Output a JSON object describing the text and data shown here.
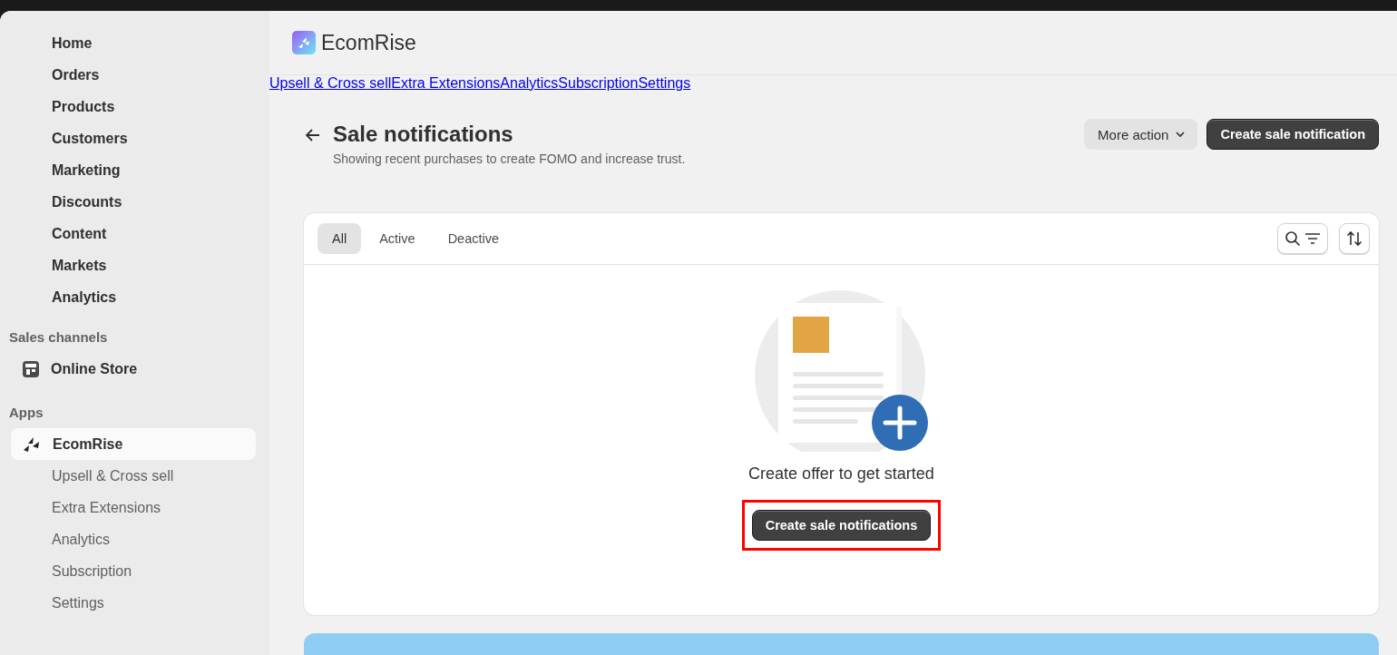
{
  "sidebar": {
    "main_items": [
      "Home",
      "Orders",
      "Products",
      "Customers",
      "Marketing",
      "Discounts",
      "Content",
      "Markets",
      "Analytics"
    ],
    "sales_channels": {
      "heading": "Sales channels",
      "items": [
        "Online Store"
      ]
    },
    "apps": {
      "heading": "Apps",
      "items": [
        {
          "label": "EcomRise",
          "kind": "app",
          "selected": true
        },
        {
          "label": "Upsell & Cross sell",
          "kind": "sub",
          "selected": false
        },
        {
          "label": "Extra Extensions",
          "kind": "sub",
          "selected": false
        },
        {
          "label": "Analytics",
          "kind": "sub",
          "selected": false
        },
        {
          "label": "Subscription",
          "kind": "sub",
          "selected": false
        },
        {
          "label": "Settings",
          "kind": "sub",
          "selected": false
        }
      ]
    }
  },
  "app_header": {
    "title": "EcomRise"
  },
  "links": [
    "Upsell & Cross sell",
    "Extra Extensions",
    "Analytics",
    "Subscription",
    "Settings"
  ],
  "page": {
    "title": "Sale notifications",
    "subtitle": "Showing recent purchases to create FOMO and increase trust.",
    "more_action": "More action",
    "primary_action": "Create sale notification"
  },
  "card": {
    "tabs": [
      {
        "label": "All",
        "selected": true
      },
      {
        "label": "Active",
        "selected": false
      },
      {
        "label": "Deactive",
        "selected": false
      }
    ],
    "empty_state": {
      "message": "Create offer to get started",
      "button": "Create sale notifications",
      "highlighted": true
    }
  }
}
